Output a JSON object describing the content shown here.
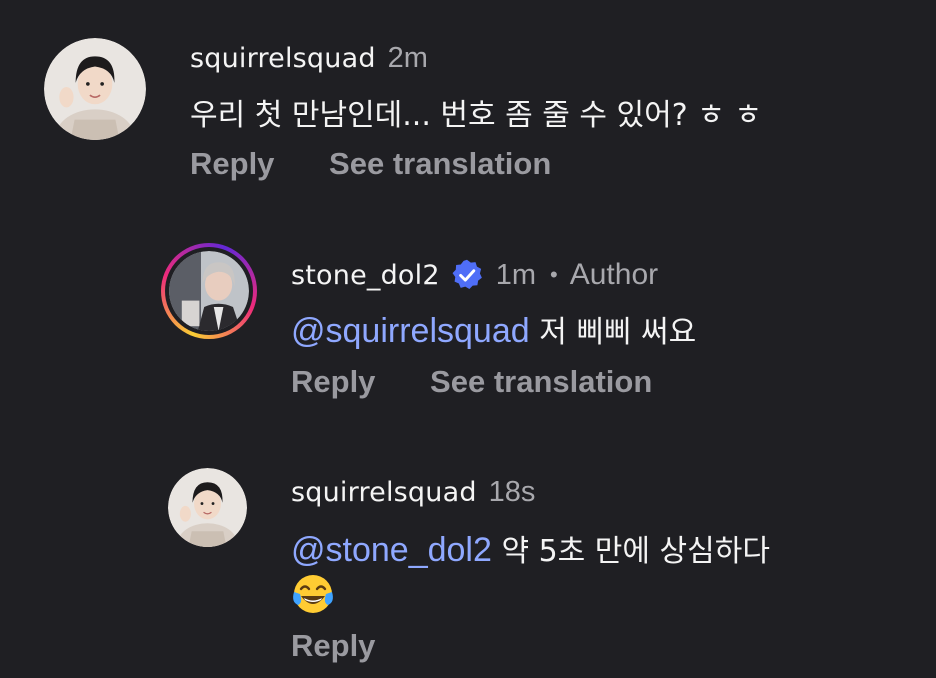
{
  "comments": [
    {
      "username": "squirrelsquad",
      "time": "2m",
      "text": "우리 첫 만남인데... 번호 좀 줄 수 있어? ㅎ ㅎ",
      "actions": {
        "reply": "Reply",
        "translate": "See translation"
      }
    },
    {
      "username": "stone_dol2",
      "time": "1m",
      "separator": "•",
      "role": "Author",
      "mention": "@squirrelsquad",
      "text": "저 삐삐 써요",
      "actions": {
        "reply": "Reply",
        "translate": "See translation"
      }
    },
    {
      "username": "squirrelsquad",
      "time": "18s",
      "mention": "@stone_dol2",
      "text": "약 5초 만에 상심하다",
      "emoji": "face-with-tears-of-joy",
      "actions": {
        "reply": "Reply"
      }
    }
  ],
  "colors": {
    "background": "#1f1f23",
    "mention": "#8fa8ff",
    "muted": "#a8a8ad",
    "verified": "#4f6ef7"
  }
}
